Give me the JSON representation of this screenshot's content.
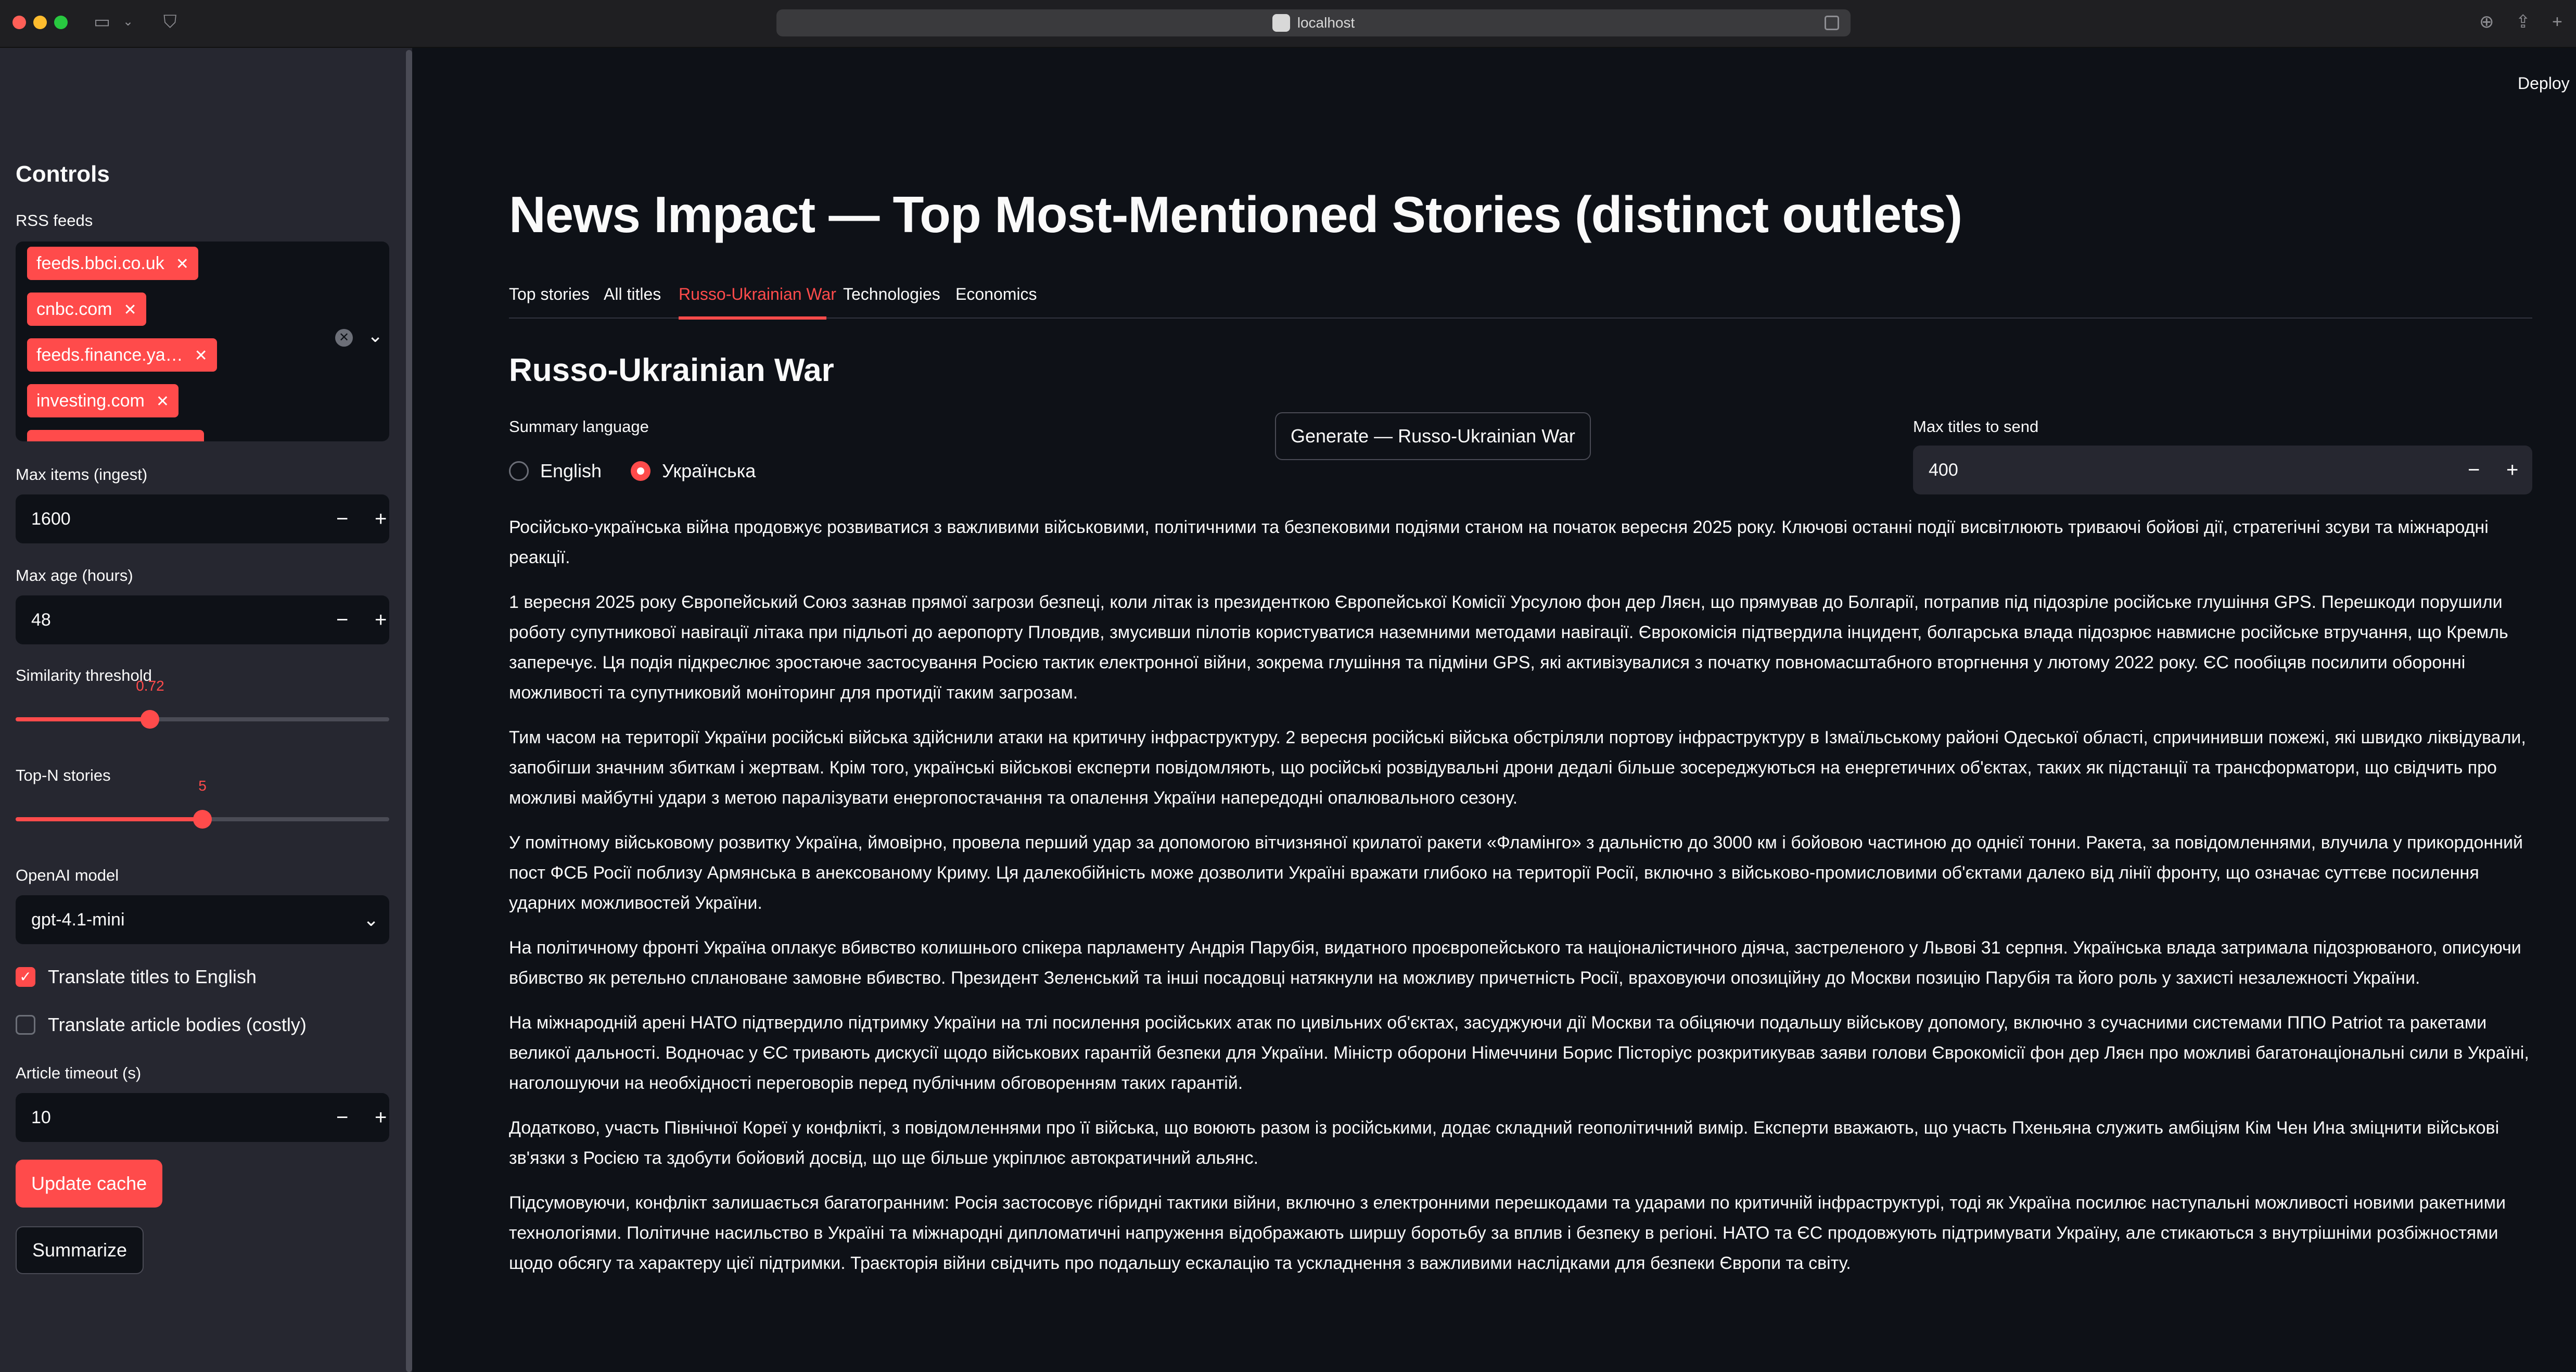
{
  "browser": {
    "url": "localhost"
  },
  "header": {
    "deploy_label": "Deploy"
  },
  "sidebar": {
    "title": "Controls",
    "rss_label": "RSS feeds",
    "rss_tags": [
      "feeds.bbci.co.uk",
      "cnbc.com",
      "feeds.finance.ya…",
      "investing.com",
      ""
    ],
    "max_items_label": "Max items (ingest)",
    "max_items_value": "1600",
    "max_age_label": "Max age (hours)",
    "max_age_value": "48",
    "similarity_label": "Similarity threshold",
    "similarity_value": "0.72",
    "similarity_fraction": 0.72,
    "topn_label": "Top-N stories",
    "topn_value": "5",
    "topn_fraction": 0.5,
    "model_label": "OpenAI model",
    "model_value": "gpt-4.1-mini",
    "translate_titles_label": "Translate titles to English",
    "translate_titles_checked": true,
    "translate_bodies_label": "Translate article bodies (costly)",
    "translate_bodies_checked": false,
    "timeout_label": "Article timeout (s)",
    "timeout_value": "10",
    "update_cache_label": "Update cache",
    "summarize_label": "Summarize"
  },
  "main": {
    "title": "News Impact — Top Most-Mentioned Stories (distinct outlets)",
    "tabs": [
      {
        "label": "Top stories"
      },
      {
        "label": "All titles"
      },
      {
        "label": "Russo-Ukrainian War"
      },
      {
        "label": "Technologies"
      },
      {
        "label": "Economics"
      }
    ],
    "active_tab": "Russo-Ukrainian War",
    "section_title": "Russo-Ukrainian War",
    "language_label": "Summary language",
    "language_options": [
      "English",
      "Українська"
    ],
    "language_selected": "Українська",
    "generate_label": "Generate — Russo-Ukrainian War",
    "max_titles_label": "Max titles to send",
    "max_titles_value": "400",
    "paragraphs": [
      "Російсько-українська війна продовжує розвиватися з важливими військовими, політичними та безпековими подіями станом на початок вересня 2025 року. Ключові останні події висвітлюють триваючі бойові дії, стратегічні зсуви та міжнародні реакції.",
      "1 вересня 2025 року Європейський Союз зазнав прямої загрози безпеці, коли літак із президенткою Європейської Комісії Урсулою фон дер Ляєн, що прямував до Болгарії, потрапив під підозріле російське глушіння GPS. Перешкоди порушили роботу супутникової навігації літака при підльоті до аеропорту Пловдив, змусивши пілотів користуватися наземними методами навігації. Єврокомісія підтвердила інцидент, болгарська влада підозрює навмисне російське втручання, що Кремль заперечує. Ця подія підкреслює зростаюче застосування Росією тактик електронної війни, зокрема глушіння та підміни GPS, які активізувалися з початку повномасштабного вторгнення у лютому 2022 року. ЄС пообіцяв посилити оборонні можливості та супутниковий моніторинг для протидії таким загрозам.",
      "Тим часом на території України російські війська здійснили атаки на критичну інфраструктуру. 2 вересня російські війська обстріляли портову інфраструктуру в Ізмаїльському районі Одеської області, спричинивши пожежі, які швидко ліквідували, запобігши значним збиткам і жертвам. Крім того, українські військові експерти повідомляють, що російські розвідувальні дрони дедалі більше зосереджуються на енергетичних об'єктах, таких як підстанції та трансформатори, що свідчить про можливі майбутні удари з метою паралізувати енергопостачання та опалення України напередодні опалювального сезону.",
      "У помітному військовому розвитку Україна, ймовірно, провела перший удар за допомогою вітчизняної крилатої ракети «Фламінго» з дальністю до 3000 км і бойовою частиною до однієї тонни. Ракета, за повідомленнями, влучила у прикордонний пост ФСБ Росії поблизу Армянська в анексованому Криму. Ця далекобійність може дозволити Україні вражати глибоко на території Росії, включно з військово-промисловими об'єктами далеко від лінії фронту, що означає суттєве посилення ударних можливостей України.",
      "На політичному фронті Україна оплакує вбивство колишнього спікера парламенту Андрія Парубія, видатного проєвропейського та націоналістичного діяча, застреленого у Львові 31 серпня. Українська влада затримала підозрюваного, описуючи вбивство як ретельно сплановане замовне вбивство. Президент Зеленський та інші посадовці натякнули на можливу причетність Росії, враховуючи опозиційну до Москви позицію Парубія та його роль у захисті незалежності України.",
      "На міжнародній арені НАТО підтвердило підтримку України на тлі посилення російських атак по цивільних об'єктах, засуджуючи дії Москви та обіцяючи подальшу військову допомогу, включно з сучасними системами ППО Patriot та ракетами великої дальності. Водночас у ЄС тривають дискусії щодо військових гарантій безпеки для України. Міністр оборони Німеччини Борис Пісторіус розкритикував заяви голови Єврокомісії фон дер Ляєн про можливі багатонаціональні сили в Україні, наголошуючи на необхідності переговорів перед публічним обговоренням таких гарантій.",
      "Додатково, участь Північної Кореї у конфлікті, з повідомленнями про її війська, що воюють разом із російськими, додає складний геополітичний вимір. Експерти вважають, що участь Пхеньяна служить амбіціям Кім Чен Ина зміцнити військові зв'язки з Росією та здобути бойовий досвід, що ще більше укріплює автократичний альянс.",
      "Підсумовуючи, конфлікт залишається багатогранним: Росія застосовує гібридні тактики війни, включно з електронними перешкодами та ударами по критичній інфраструктурі, тоді як Україна посилює наступальні можливості новими ракетними технологіями. Політичне насильство в Україні та міжнародні дипломатичні напруження відображають ширшу боротьбу за вплив і безпеку в регіоні. НАТО та ЄС продовжують підтримувати Україну, але стикаються з внутрішніми розбіжностями щодо обсягу та характеру цієї підтримки. Траєкторія війни свідчить про подальшу ескалацію та ускладнення з важливими наслідками для безпеки Європи та світу."
    ]
  },
  "colors": {
    "accent": "#ff4b4b",
    "background": "#0e1117",
    "sidebar": "#262730"
  }
}
